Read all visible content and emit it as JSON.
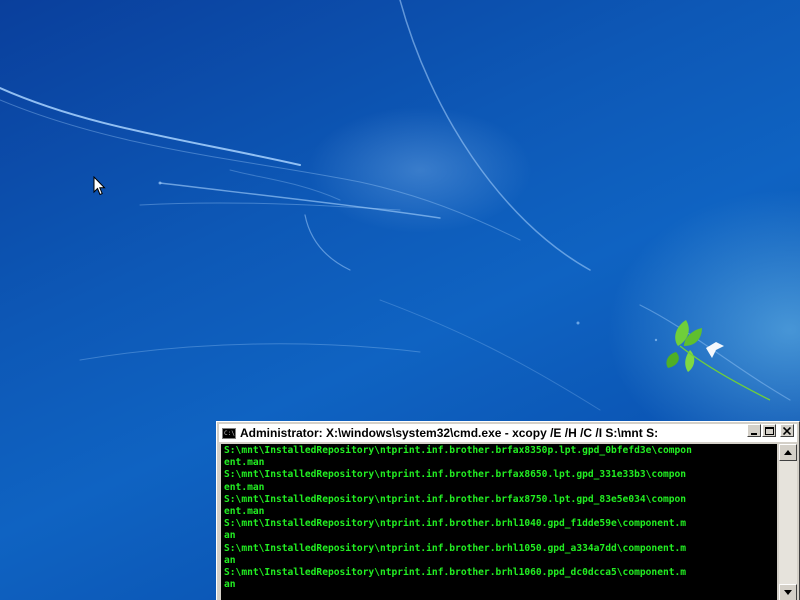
{
  "console": {
    "title": "Administrator: X:\\windows\\system32\\cmd.exe - xcopy  /E /H /C /I S:\\mnt S:",
    "icon_text": "C:\\",
    "lines": [
      "S:\\mnt\\InstalledRepository\\ntprint.inf.brother.brfax8350p.lpt.gpd_0bfefd3e\\compon",
      "ent.man",
      "S:\\mnt\\InstalledRepository\\ntprint.inf.brother.brfax8650.lpt.gpd_331e33b3\\compon",
      "ent.man",
      "S:\\mnt\\InstalledRepository\\ntprint.inf.brother.brfax8750.lpt.gpd_83e5e034\\compon",
      "ent.man",
      "S:\\mnt\\InstalledRepository\\ntprint.inf.brother.brhl1040.gpd_f1dde59e\\component.m",
      "an",
      "S:\\mnt\\InstalledRepository\\ntprint.inf.brother.brhl1050.gpd_a334a7dd\\component.m",
      "an",
      "S:\\mnt\\InstalledRepository\\ntprint.inf.brother.brhl1060.ppd_dc0dcca5\\component.m",
      "an"
    ],
    "text_color": "#22ee22",
    "background_color": "#000000"
  },
  "icons": {
    "cursor": "mouse-pointer-icon",
    "minimize": "minimize-icon",
    "maximize": "maximize-icon",
    "close": "close-icon",
    "scroll_up": "arrow-up-icon",
    "scroll_down": "arrow-down-icon"
  }
}
